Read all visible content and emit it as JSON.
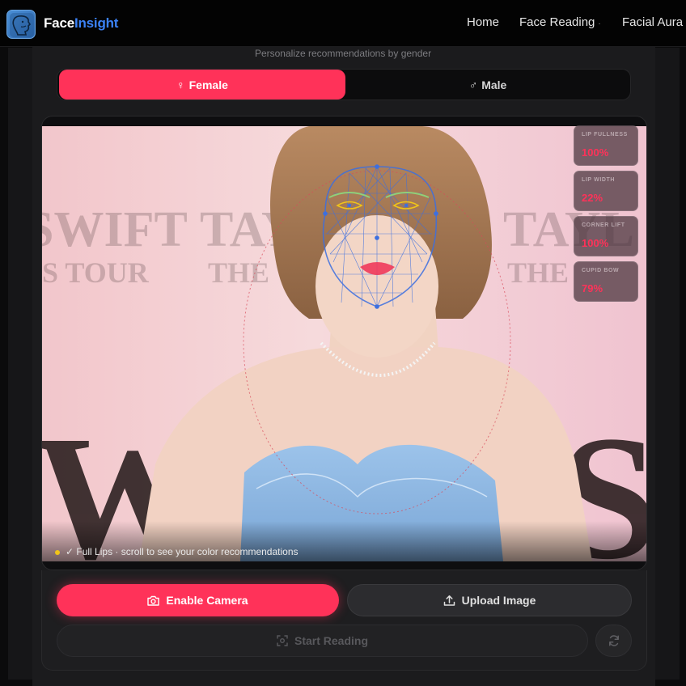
{
  "app": {
    "brand_main": "Face",
    "brand_accent": "Insight",
    "logo_icon": "face-profile-icon",
    "accent_color": "#ff3259",
    "brand_color": "#3b82f6"
  },
  "nav": {
    "home": "Home",
    "face_reading": "Face Reading",
    "face_reading_caret": "·",
    "facial_aura": "Facial Aura"
  },
  "gender": {
    "subtitle": "Personalize recommendations by gender",
    "female_label": "Female",
    "female_symbol": "♀",
    "male_label": "Male",
    "male_symbol": "♂",
    "selected": "Female"
  },
  "metrics": [
    {
      "label": "LIP FULLNESS",
      "value": "100%"
    },
    {
      "label": "LIP WIDTH",
      "value": "22%"
    },
    {
      "label": "CORNER LIFT",
      "value": "100%"
    },
    {
      "label": "CUPID BOW",
      "value": "79%"
    }
  ],
  "status": {
    "text": "✓ Full Lips · scroll to see your color recommendations",
    "dot_color": "#f0c419"
  },
  "actions": {
    "camera": "Enable Camera",
    "camera_icon": "camera-icon",
    "upload": "Upload Image",
    "upload_icon": "upload-icon",
    "start": "Start Reading",
    "start_icon": "scan-icon",
    "refresh_icon": "refresh-icon"
  }
}
